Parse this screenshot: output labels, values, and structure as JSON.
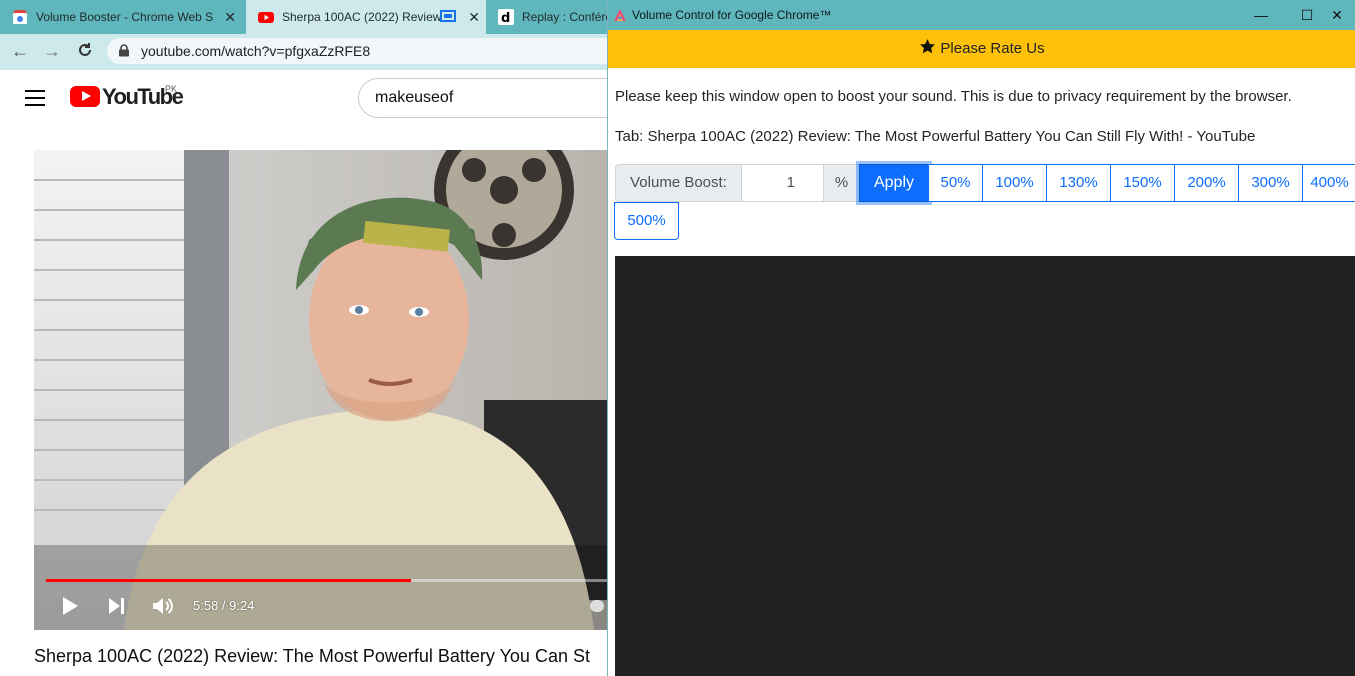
{
  "browser": {
    "tabs": [
      {
        "title": "Volume Booster - Chrome Web S",
        "favicon": "chrome-webstore-icon",
        "active": false
      },
      {
        "title": "Sherpa 100AC (2022) Review",
        "favicon": "youtube-icon",
        "active": true
      },
      {
        "title": "Replay : Conféré",
        "favicon": "dailymotion-icon",
        "active": false
      }
    ],
    "url": "youtube.com/watch?v=pfgxaZzRFE8"
  },
  "youtube": {
    "wordmark": "YouTube",
    "region": "PK",
    "search_value": "makeuseof",
    "player": {
      "time": "5:58 / 9:24",
      "progress": 0.65
    },
    "video_title": "Sherpa 100AC (2022) Review: The Most Powerful Battery You Can St"
  },
  "popup": {
    "window_title": "Volume Control for Google Chrome™",
    "rate_label": "Please Rate Us",
    "notice": "Please keep this window open to boost your sound. This is due to privacy requirement by the browser.",
    "tab_line": "Tab: Sherpa 100AC (2022) Review: The Most Powerful Battery You Can Still Fly With! - YouTube",
    "volume_label": "Volume Boost:",
    "volume_value": "1",
    "percent_symbol": "%",
    "apply_label": "Apply",
    "presets": [
      "50%",
      "100%",
      "130%",
      "150%",
      "200%",
      "300%",
      "400%",
      "500%"
    ]
  },
  "colors": {
    "titlebar": "#5fb6bd",
    "rate_bar": "#ffc107",
    "primary": "#0d6efd",
    "youtube_red": "#ff0000"
  }
}
